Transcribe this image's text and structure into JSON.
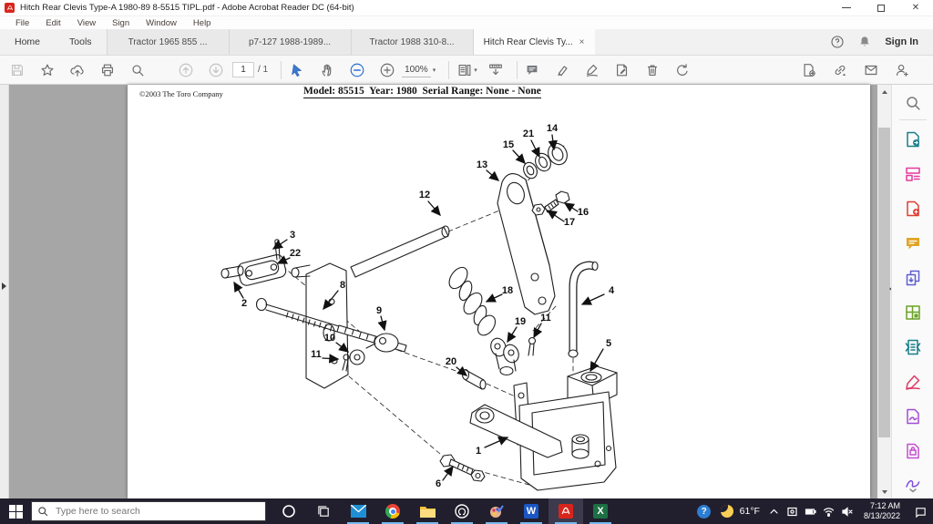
{
  "window": {
    "title": "Hitch Rear Clevis Type-A 1980-89 8-5515 TIPL.pdf - Adobe Acrobat Reader DC (64-bit)"
  },
  "menu": {
    "items": [
      "File",
      "Edit",
      "View",
      "Sign",
      "Window",
      "Help"
    ]
  },
  "tabbar": {
    "home": "Home",
    "tools": "Tools",
    "doc_tabs": [
      {
        "label": "Tractor 1965 855 ..."
      },
      {
        "label": "p7-127 1988-1989..."
      },
      {
        "label": "Tractor 1988 310-8..."
      },
      {
        "label": "Hitch Rear Clevis Ty...",
        "close": "×"
      }
    ],
    "sign_in": "Sign In"
  },
  "toolbar": {
    "page_number": "1",
    "page_count": "/ 1",
    "zoom": "100%"
  },
  "page": {
    "copyright": "©2003 The Toro Company",
    "model_header": "Model: 85515  Year: 1980  Serial Range: None - None",
    "callouts": [
      "1",
      "2",
      "3",
      "4",
      "5",
      "6",
      "8",
      "9",
      "10",
      "11",
      "11",
      "12",
      "13",
      "14",
      "15",
      "16",
      "17",
      "18",
      "19",
      "20",
      "21",
      "22"
    ]
  },
  "taskbar": {
    "search_placeholder": "Type here to search",
    "weather": "61°F",
    "clock": {
      "time": "7:12 AM",
      "date": "8/13/2022"
    }
  },
  "colors": {
    "acrobat_red": "#d8251c",
    "accent_blue": "#3a79d2",
    "taskbar_underline": "#76b9ed"
  }
}
